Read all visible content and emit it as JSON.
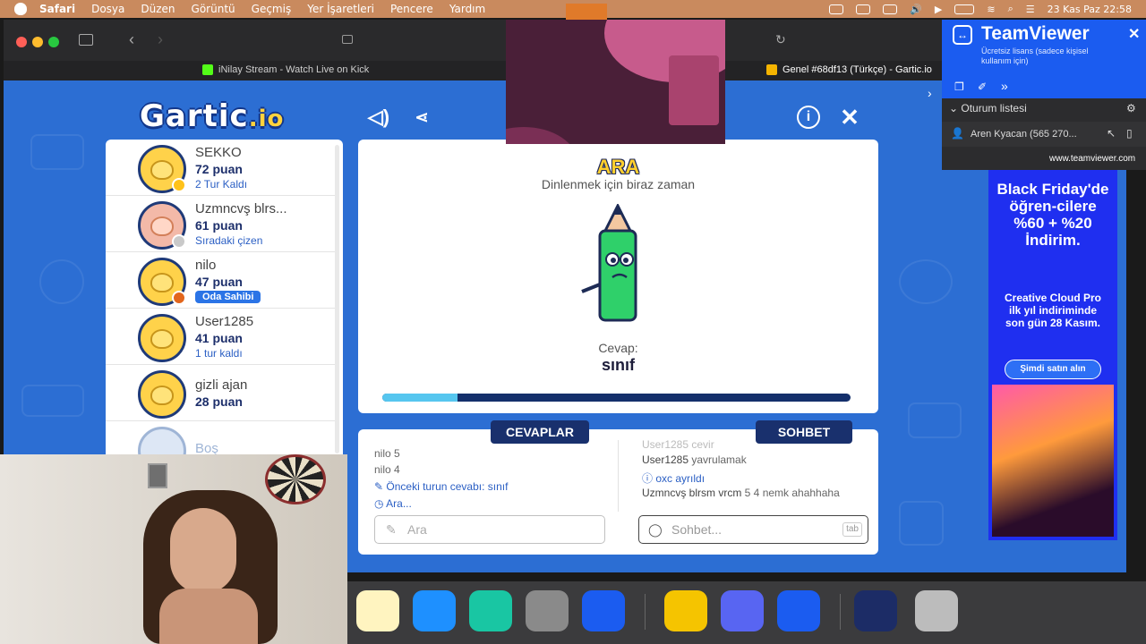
{
  "menubar": {
    "app": "Safari",
    "items": [
      "Dosya",
      "Düzen",
      "Görüntü",
      "Geçmiş",
      "Yer İşaretleri",
      "Pencere",
      "Yardım"
    ],
    "datetime": "23 Kas Paz  22:58"
  },
  "tabs": [
    {
      "label": "iNilay Stream - Watch Live on Kick"
    },
    {
      "label": "Genel #68df13 (Türkçe) - Gartic.io"
    }
  ],
  "game": {
    "logo_main": "Gartic",
    "logo_suffix": ".io",
    "players": [
      {
        "name": "SEKKO",
        "points": "72 puan",
        "status": "2 Tur Kaldı"
      },
      {
        "name": "Uzmncvş blrs...",
        "points": "61 puan",
        "status": "Sıradaki çizen"
      },
      {
        "name": "nilo",
        "points": "47 puan",
        "status": "Oda Sahibi"
      },
      {
        "name": "User1285",
        "points": "41 puan",
        "status": "1 tur kaldı"
      },
      {
        "name": "gizli ajan",
        "points": "28 puan",
        "status": ""
      },
      {
        "name": "Boş",
        "points": "",
        "status": ""
      }
    ],
    "center": {
      "title": "ARA",
      "subtitle": "Dinlenmek için biraz zaman",
      "answer_label": "Cevap:",
      "answer_value": "sınıf",
      "progress": 0.16
    },
    "answers": {
      "header": "CEVAPLAR",
      "lines": [
        "nilo 5",
        "nilo 4"
      ],
      "prev_label": "Önceki turun cevabı:",
      "prev_value": "sınıf",
      "ara": "Ara...",
      "input_placeholder": "Ara"
    },
    "chat": {
      "header": "SOHBET",
      "partial": "User1285 cevir",
      "lines": [
        {
          "user": "User1285",
          "text": "yavrulamak"
        },
        {
          "user": "",
          "text": "oxc ayrıldı"
        },
        {
          "user": "Uzmncvş blrsm vrcm",
          "text": "5 4 nemk ahahhaha"
        }
      ],
      "input_placeholder": "Sohbet...",
      "tab_hint": "tab"
    }
  },
  "ad": {
    "headline": "Black Friday'de öğren-cilere %60 + %20 İndirim.",
    "body": "Creative Cloud Pro ilk yıl indiriminde son gün 28 Kasım.",
    "cta": "Şimdi satın alın"
  },
  "teamviewer": {
    "title": "TeamViewer",
    "license": "Ücretsiz lisans (sadece kişisel kullanım için)",
    "session_list": "Oturum listesi",
    "session_user": "Aren Kyacan (565 270...",
    "url": "www.teamviewer.com"
  },
  "colors": {
    "game_bg": "#2c6ed3",
    "header_navy": "#19306d",
    "menubar": "#c98a5e",
    "teamviewer_blue": "#1b5cf0"
  }
}
